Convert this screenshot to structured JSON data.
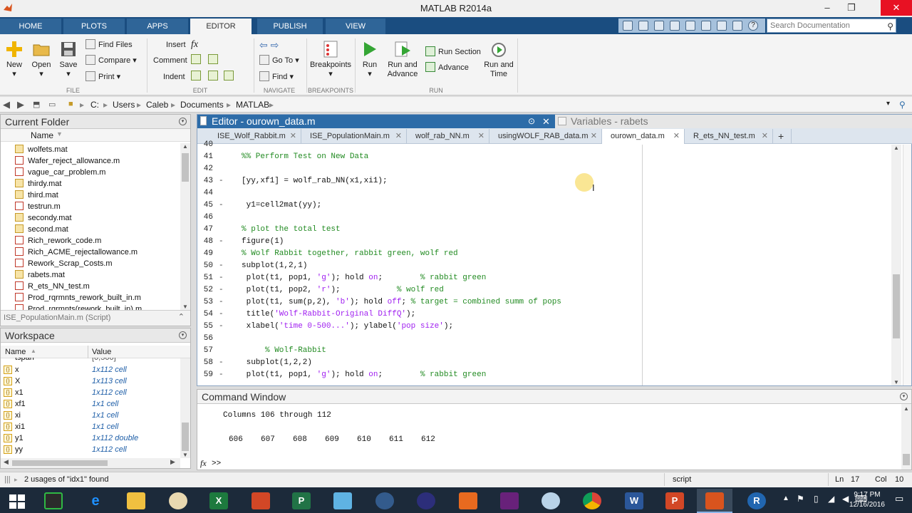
{
  "window": {
    "title": "MATLAB R2014a"
  },
  "ribbon_tabs": [
    "HOME",
    "PLOTS",
    "APPS",
    "EDITOR",
    "PUBLISH",
    "VIEW"
  ],
  "search": {
    "placeholder": "Search Documentation"
  },
  "ribbon": {
    "file": {
      "new": "New",
      "open": "Open",
      "save": "Save",
      "find_files": "Find Files",
      "compare": "Compare",
      "print": "Print",
      "group": "FILE"
    },
    "edit": {
      "insert": "Insert",
      "comment": "Comment",
      "indent": "Indent",
      "group": "EDIT"
    },
    "navigate": {
      "go_to": "Go To",
      "find": "Find",
      "group": "NAVIGATE"
    },
    "breakpoints": {
      "label": "Breakpoints",
      "group": "BREAKPOINTS"
    },
    "run": {
      "run": "Run",
      "run_and_advance": "Run and Advance",
      "run_section": "Run Section",
      "advance": "Advance",
      "run_and_time": "Run and Time",
      "group": "RUN"
    }
  },
  "path": [
    "C:",
    "Users",
    "Caleb",
    "Documents",
    "MATLAB"
  ],
  "current_folder": {
    "title": "Current Folder",
    "column": "Name",
    "files": [
      {
        "name": "wolfets.mat",
        "type": "mat"
      },
      {
        "name": "Wafer_reject_allowance.m",
        "type": "m"
      },
      {
        "name": "vague_car_problem.m",
        "type": "m"
      },
      {
        "name": "thirdy.mat",
        "type": "mat"
      },
      {
        "name": "third.mat",
        "type": "mat"
      },
      {
        "name": "testrun.m",
        "type": "m"
      },
      {
        "name": "secondy.mat",
        "type": "mat"
      },
      {
        "name": "second.mat",
        "type": "mat"
      },
      {
        "name": "Rich_rework_code.m",
        "type": "m"
      },
      {
        "name": "Rich_ACME_rejectallowance.m",
        "type": "m"
      },
      {
        "name": "Rework_Scrap_Costs.m",
        "type": "m"
      },
      {
        "name": "rabets.mat",
        "type": "mat"
      },
      {
        "name": "R_ets_NN_test.m",
        "type": "m"
      },
      {
        "name": "Prod_rqrmnts_rework_built_in.m",
        "type": "m"
      },
      {
        "name": "Prod_rqrmnts(rework_built_in).m",
        "type": "m"
      }
    ],
    "details": "ISE_PopulationMain.m (Script)"
  },
  "workspace": {
    "title": "Workspace",
    "col_name": "Name",
    "col_value": "Value",
    "partial_row": {
      "name": "tspan",
      "value": "[0,500]"
    },
    "vars": [
      {
        "name": "x",
        "value": "1x112 cell"
      },
      {
        "name": "X",
        "value": "1x113 cell"
      },
      {
        "name": "x1",
        "value": "1x112 cell"
      },
      {
        "name": "xf1",
        "value": "1x1 cell"
      },
      {
        "name": "xi",
        "value": "1x1 cell"
      },
      {
        "name": "xi1",
        "value": "1x1 cell"
      },
      {
        "name": "y1",
        "value": "1x112 double"
      },
      {
        "name": "yy",
        "value": "1x112 cell"
      }
    ]
  },
  "editor": {
    "title": "Editor - ourown_data.m",
    "variables_title": "Variables - rabets",
    "tabs": [
      {
        "label": "ISE_Wolf_Rabbit.m"
      },
      {
        "label": "ISE_PopulationMain.m"
      },
      {
        "label": "wolf_rab_NN.m"
      },
      {
        "label": "usingWOLF_RAB_data.m"
      },
      {
        "label": "ourown_data.m"
      },
      {
        "label": "R_ets_NN_test.m"
      }
    ],
    "lines": [
      {
        "n": "40",
        "d": "",
        "i": 0,
        "parts": []
      },
      {
        "n": "41",
        "d": "",
        "i": 0,
        "parts": [
          {
            "t": "%% Perform Test on New Data",
            "c": "cm"
          }
        ]
      },
      {
        "n": "42",
        "d": "",
        "i": 0,
        "parts": []
      },
      {
        "n": "43",
        "d": "-",
        "i": 0,
        "parts": [
          {
            "t": "[yy,xf1] = wolf_rab_NN(x1,xi1);",
            "c": ""
          }
        ]
      },
      {
        "n": "44",
        "d": "",
        "i": 0,
        "parts": []
      },
      {
        "n": "45",
        "d": "-",
        "i": 1,
        "parts": [
          {
            "t": "y1=cell2mat(yy);",
            "c": ""
          }
        ]
      },
      {
        "n": "46",
        "d": "",
        "i": 0,
        "parts": []
      },
      {
        "n": "47",
        "d": "",
        "i": 0,
        "parts": [
          {
            "t": "% plot the total test",
            "c": "cm"
          }
        ]
      },
      {
        "n": "48",
        "d": "-",
        "i": 0,
        "parts": [
          {
            "t": "figure(1)",
            "c": ""
          }
        ]
      },
      {
        "n": "49",
        "d": "",
        "i": 0,
        "parts": [
          {
            "t": "% Wolf Rabbit together, rabbit green, wolf red",
            "c": "cm"
          }
        ]
      },
      {
        "n": "50",
        "d": "-",
        "i": 0,
        "parts": [
          {
            "t": "subplot(1,2,1)",
            "c": ""
          }
        ]
      },
      {
        "n": "51",
        "d": "-",
        "i": 1,
        "parts": [
          {
            "t": "plot(t1, pop1, ",
            "c": ""
          },
          {
            "t": "'g'",
            "c": "str"
          },
          {
            "t": "); hold ",
            "c": ""
          },
          {
            "t": "on",
            "c": "str"
          },
          {
            "t": ";        ",
            "c": ""
          },
          {
            "t": "% rabbit green",
            "c": "cm"
          }
        ]
      },
      {
        "n": "52",
        "d": "-",
        "i": 1,
        "parts": [
          {
            "t": "plot(t1, pop2, ",
            "c": ""
          },
          {
            "t": "'r'",
            "c": "str"
          },
          {
            "t": ");            ",
            "c": ""
          },
          {
            "t": "% wolf red",
            "c": "cm"
          }
        ]
      },
      {
        "n": "53",
        "d": "-",
        "i": 1,
        "parts": [
          {
            "t": "plot(t1, sum(p,2), ",
            "c": ""
          },
          {
            "t": "'b'",
            "c": "str"
          },
          {
            "t": "); hold ",
            "c": ""
          },
          {
            "t": "off",
            "c": "str"
          },
          {
            "t": "; ",
            "c": ""
          },
          {
            "t": "% target = combined summ of pops",
            "c": "cm"
          }
        ]
      },
      {
        "n": "54",
        "d": "-",
        "i": 1,
        "parts": [
          {
            "t": "title(",
            "c": ""
          },
          {
            "t": "'Wolf-Rabbit-Original DiffQ'",
            "c": "str"
          },
          {
            "t": ");",
            "c": ""
          }
        ]
      },
      {
        "n": "55",
        "d": "-",
        "i": 1,
        "parts": [
          {
            "t": "xlabel(",
            "c": ""
          },
          {
            "t": "'time 0-500...'",
            "c": "str"
          },
          {
            "t": "); ylabel(",
            "c": ""
          },
          {
            "t": "'pop size'",
            "c": "str"
          },
          {
            "t": ");",
            "c": ""
          }
        ]
      },
      {
        "n": "56",
        "d": "",
        "i": 0,
        "parts": []
      },
      {
        "n": "57",
        "d": "",
        "i": 5,
        "parts": [
          {
            "t": "% Wolf-Rabbit",
            "c": "cm"
          }
        ]
      },
      {
        "n": "58",
        "d": "-",
        "i": 1,
        "parts": [
          {
            "t": "subplot(1,2,2)",
            "c": ""
          }
        ]
      },
      {
        "n": "59",
        "d": "-",
        "i": 1,
        "parts": [
          {
            "t": "plot(t1, pop1, ",
            "c": ""
          },
          {
            "t": "'g'",
            "c": "str"
          },
          {
            "t": "); hold ",
            "c": ""
          },
          {
            "t": "on",
            "c": "str"
          },
          {
            "t": ";        ",
            "c": ""
          },
          {
            "t": "% rabbit green",
            "c": "cm"
          }
        ]
      }
    ]
  },
  "command_window": {
    "title": "Command Window",
    "columns_text": "Columns 106 through 112",
    "values": [
      "606",
      "607",
      "608",
      "609",
      "610",
      "611",
      "612"
    ],
    "fx": "fx",
    "prompt": ">>"
  },
  "status": {
    "message": "2 usages of \"idx1\" found",
    "mode": "script",
    "ln_label": "Ln",
    "ln": "17",
    "col_label": "Col",
    "col": "10"
  },
  "taskbar": {
    "time": "9:17 PM",
    "date": "12/16/2016"
  }
}
